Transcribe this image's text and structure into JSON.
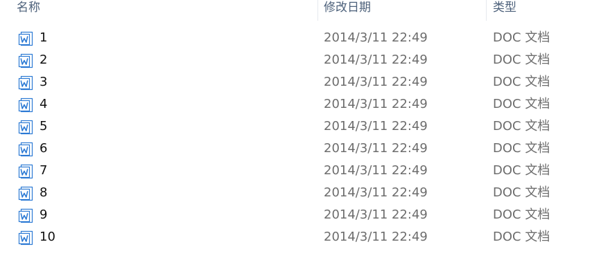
{
  "columns": {
    "name": "名称",
    "date": "修改日期",
    "type": "类型"
  },
  "accent_color": "#2b79d4",
  "icon": "word-document-icon",
  "rows": [
    {
      "name": "1",
      "date": "2014/3/11 22:49",
      "type": "DOC 文档"
    },
    {
      "name": "2",
      "date": "2014/3/11 22:49",
      "type": "DOC 文档"
    },
    {
      "name": "3",
      "date": "2014/3/11 22:49",
      "type": "DOC 文档"
    },
    {
      "name": "4",
      "date": "2014/3/11 22:49",
      "type": "DOC 文档"
    },
    {
      "name": "5",
      "date": "2014/3/11 22:49",
      "type": "DOC 文档"
    },
    {
      "name": "6",
      "date": "2014/3/11 22:49",
      "type": "DOC 文档"
    },
    {
      "name": "7",
      "date": "2014/3/11 22:49",
      "type": "DOC 文档"
    },
    {
      "name": "8",
      "date": "2014/3/11 22:49",
      "type": "DOC 文档"
    },
    {
      "name": "9",
      "date": "2014/3/11 22:49",
      "type": "DOC 文档"
    },
    {
      "name": "10",
      "date": "2014/3/11 22:49",
      "type": "DOC 文档"
    }
  ]
}
